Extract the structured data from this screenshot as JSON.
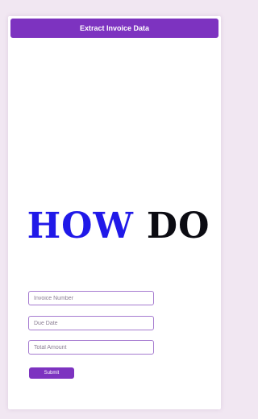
{
  "header": {
    "title": "Extract Invoice Data"
  },
  "hero": {
    "word1": "HOW",
    "word2": "DO"
  },
  "form": {
    "invoice_number_placeholder": "Invoice Number",
    "due_date_placeholder": "Due Date",
    "total_amount_placeholder": "Total Amount",
    "submit_label": "Submit"
  },
  "colors": {
    "accent": "#7d33c0",
    "page_background": "#f1e7f2",
    "hero_blue": "#2019e8",
    "hero_black": "#0b0b12"
  }
}
